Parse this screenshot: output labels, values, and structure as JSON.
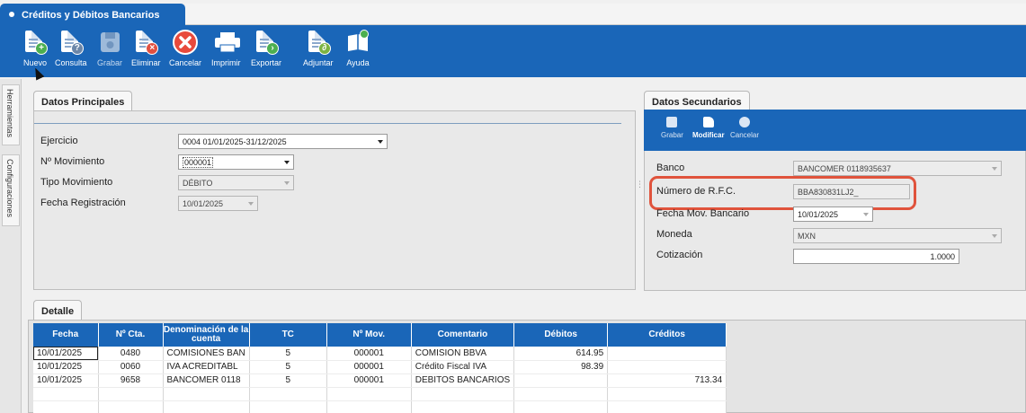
{
  "window": {
    "title": "Créditos y Débitos Bancarios"
  },
  "toolbar": {
    "buttons": [
      {
        "label": "Nuevo",
        "icon": "new-document-icon"
      },
      {
        "label": "Consulta",
        "icon": "query-document-icon"
      },
      {
        "label": "Grabar",
        "icon": "save-disk-icon"
      },
      {
        "label": "Eliminar",
        "icon": "delete-document-icon"
      },
      {
        "label": "Cancelar",
        "icon": "cancel-circle-icon"
      },
      {
        "label": "Imprimir",
        "icon": "printer-icon"
      },
      {
        "label": "Exportar",
        "icon": "export-document-icon"
      },
      {
        "label": "Adjuntar",
        "icon": "attach-document-icon"
      },
      {
        "label": "Ayuda",
        "icon": "help-book-icon"
      }
    ]
  },
  "side_tabs": {
    "tools": "Herramientas",
    "config": "Configuraciones"
  },
  "principal": {
    "tab": "Datos Principales",
    "fields": {
      "ejercicio": {
        "label": "Ejercicio",
        "value": "0004 01/01/2025-31/12/2025"
      },
      "movimiento": {
        "label": "Nº Movimiento",
        "value": "000001"
      },
      "tipo": {
        "label": "Tipo Movimiento",
        "value": "DÉBITO"
      },
      "fecha": {
        "label": "Fecha Registración",
        "value": "10/01/2025"
      }
    }
  },
  "secundarios": {
    "tab": "Datos Secundarios",
    "toolbar": {
      "grabar": "Grabar",
      "modificar": "Modificar",
      "cancelar": "Cancelar"
    },
    "fields": {
      "banco": {
        "label": "Banco",
        "value": "BANCOMER 0118935637"
      },
      "rfc": {
        "label": "Número de R.F.C.",
        "value": "BBA830831LJ2_"
      },
      "fecha_mov": {
        "label": "Fecha Mov. Bancario",
        "value": "10/01/2025"
      },
      "moneda": {
        "label": "Moneda",
        "value": "MXN"
      },
      "cotizacion": {
        "label": "Cotización",
        "value": "1.0000"
      }
    }
  },
  "detalle": {
    "tab": "Detalle",
    "columns": [
      "Fecha",
      "Nº Cta.",
      "Denominación de la cuenta",
      "TC",
      "Nº Mov.",
      "Comentario",
      "Débitos",
      "Créditos"
    ],
    "rows": [
      {
        "fecha": "10/01/2025",
        "cta": "0480",
        "denominacion": "COMISIONES BAN",
        "tc": "5",
        "mov": "000001",
        "comentario": "COMISION BBVA",
        "debitos": "614.95",
        "creditos": ""
      },
      {
        "fecha": "10/01/2025",
        "cta": "0060",
        "denominacion": "IVA ACREDITABL",
        "tc": "5",
        "mov": "000001",
        "comentario": "Crédito Fiscal IVA",
        "debitos": "98.39",
        "creditos": ""
      },
      {
        "fecha": "10/01/2025",
        "cta": "9658",
        "denominacion": "BANCOMER 0118",
        "tc": "5",
        "mov": "000001",
        "comentario": "DEBITOS BANCARIOS",
        "debitos": "",
        "creditos": "713.34"
      }
    ]
  },
  "colors": {
    "primary": "#1a66b8",
    "highlight": "#e0533c",
    "panel": "#e9e9e9"
  }
}
